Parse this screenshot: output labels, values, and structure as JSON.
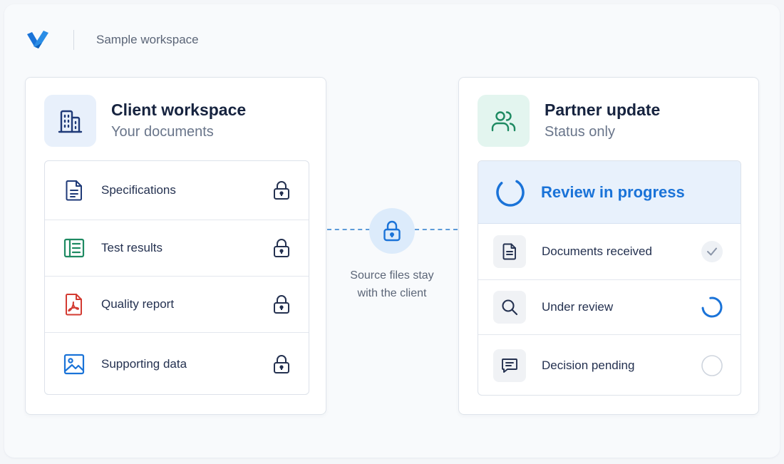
{
  "header": {
    "logo_icon": "brand-logo-icon",
    "workspace_name": "Sample workspace"
  },
  "client": {
    "title": "Client workspace",
    "subtitle": "Your documents",
    "icon": "building-icon",
    "files": [
      {
        "label": "Specifications",
        "icon": "document-icon",
        "color": "#1f3a78",
        "locked": true
      },
      {
        "label": "Test results",
        "icon": "spreadsheet-icon",
        "color": "#1e8a62",
        "locked": true
      },
      {
        "label": "Quality report",
        "icon": "pdf-icon",
        "color": "#d33b32",
        "locked": true
      },
      {
        "label": "Supporting data",
        "icon": "image-icon",
        "color": "#1a73d8",
        "locked": true
      }
    ]
  },
  "connector": {
    "icon": "lock-icon",
    "caption_line1": "Source files stay",
    "caption_line2": "with the client"
  },
  "partner": {
    "title": "Partner update",
    "subtitle": "Status only",
    "icon": "users-icon",
    "status_title": "Review in progress",
    "steps": [
      {
        "label": "Documents received",
        "icon": "document-icon",
        "state": "done"
      },
      {
        "label": "Under review",
        "icon": "search-icon",
        "state": "in-progress"
      },
      {
        "label": "Decision pending",
        "icon": "comment-icon",
        "state": "pending"
      }
    ]
  },
  "colors": {
    "accent": "#1a73d8",
    "green": "#1e8a62",
    "navy": "#16233f"
  }
}
